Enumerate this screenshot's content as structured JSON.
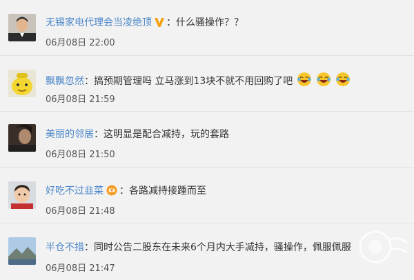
{
  "comments": [
    {
      "username": "无锡家电代理会当凌绝顶",
      "separator": "：",
      "text": "什么骚操作？？",
      "time": "06月08日 22:00",
      "badge": "verified-v-icon",
      "avatar_icon": "avatar-man-suit-icon"
    },
    {
      "username": "飘飘忽然",
      "separator": "：",
      "text": "搞预期管理吗 立马涨到13块不就不用回购了吧",
      "time": "06月08日 21:59",
      "emojis": [
        "laugh-cry-emoji",
        "laugh-cry-emoji",
        "laugh-cry-emoji"
      ],
      "avatar_icon": "avatar-yellow-cartoon-icon"
    },
    {
      "username": "美丽的邻居",
      "separator": "：",
      "text": "这明显是配合减持，玩的套路",
      "time": "06月08日 21:50",
      "avatar_icon": "avatar-dark-photo-icon"
    },
    {
      "username": "好吃不过韭菜",
      "separator": "：",
      "text": "各路减持接踵而至",
      "time": "06月08日 21:48",
      "badge": "crown-badge-icon",
      "avatar_icon": "avatar-child-icon"
    },
    {
      "username": "半仓不措",
      "separator": "：",
      "text": "同时公告二股东在未来6个月内大手减持，骚操作，佩服佩服",
      "time": "06月08日 21:47",
      "avatar_icon": "avatar-landscape-icon"
    }
  ],
  "colors": {
    "username": "#4a86c8",
    "text": "#333333",
    "time": "#555555",
    "background": "#f2f2f2"
  }
}
